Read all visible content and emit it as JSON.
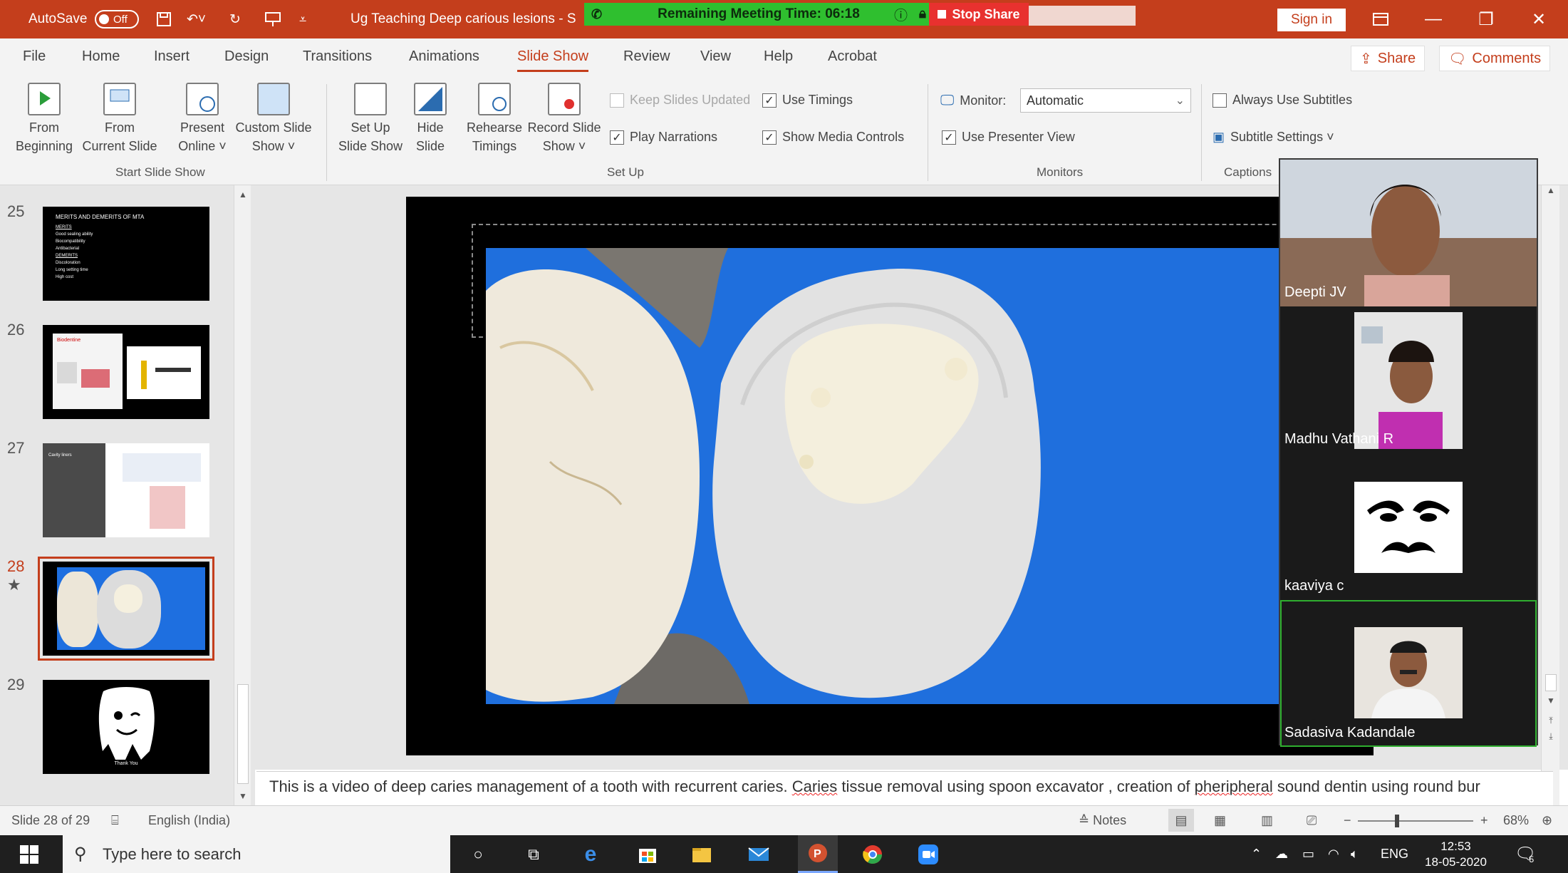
{
  "titlebar": {
    "autosave_label": "AutoSave",
    "autosave_state": "Off",
    "doc_title": "Ug Teaching Deep carious lesions  -  S",
    "meeting_timer": "Remaining Meeting Time: 06:18",
    "stop_share": "Stop Share",
    "sign_in": "Sign in",
    "accent_color": "#c43e1c"
  },
  "menu": {
    "tabs": [
      "File",
      "Home",
      "Insert",
      "Design",
      "Transitions",
      "Animations",
      "Slide Show",
      "Review",
      "View",
      "Help",
      "Acrobat"
    ],
    "active_tab": "Slide Show",
    "share": "Share",
    "comments": "Comments"
  },
  "ribbon": {
    "from_beginning": [
      "From",
      "Beginning"
    ],
    "from_current": [
      "From",
      "Current Slide"
    ],
    "present_online": [
      "Present",
      "Online ˅"
    ],
    "custom_slide_show": [
      "Custom Slide",
      "Show ˅"
    ],
    "setup_slide_show": [
      "Set Up",
      "Slide Show"
    ],
    "hide_slide": [
      "Hide",
      "Slide"
    ],
    "rehearse_timings": [
      "Rehearse",
      "Timings"
    ],
    "record_slide_show": [
      "Record Slide",
      "Show ˅"
    ],
    "keep_slides_updated": "Keep Slides Updated",
    "use_timings": "Use Timings",
    "play_narrations": "Play Narrations",
    "show_media_controls": "Show Media Controls",
    "monitor_label": "Monitor:",
    "monitor_value": "Automatic",
    "use_presenter_view": "Use Presenter View",
    "always_use_subtitles": "Always Use Subtitles",
    "subtitle_settings": "Subtitle Settings ˅",
    "groups": {
      "start": "Start Slide Show",
      "setup": "Set Up",
      "monitors": "Monitors",
      "captions": "Captions"
    }
  },
  "thumbnails": [
    {
      "num": "25",
      "title": "MERITS AND DEMERITS OF MTA",
      "lines": [
        "MERITS",
        "Good sealing ability",
        "Biocompatibility",
        "Antibacterial",
        "DEMERITS",
        "Discoloration",
        "Long setting time",
        "High cost"
      ]
    },
    {
      "num": "26",
      "title": "Biodentine"
    },
    {
      "num": "27",
      "title": "Cavity liners"
    },
    {
      "num": "28",
      "star": "★"
    },
    {
      "num": "29",
      "caption": "Thank You"
    }
  ],
  "participants": [
    {
      "name": "Deepti JV"
    },
    {
      "name": "Madhu Vathani R"
    },
    {
      "name": "kaaviya c"
    },
    {
      "name": "Sadasiva Kadandale"
    }
  ],
  "notes": {
    "part1": "This is a video of deep caries management of a tooth with recurrent caries. ",
    "squig1": "Caries",
    "part2": " tissue removal using spoon excavator , creation of ",
    "squig2": "pheripheral",
    "part3": " sound dentin using round bur"
  },
  "status": {
    "slide": "Slide 28 of 29",
    "language": "English (India)",
    "notes": "Notes",
    "zoom": "68%"
  },
  "taskbar": {
    "search_placeholder": "Type here to search",
    "lang": "ENG",
    "time": "12:53",
    "date": "18-05-2020",
    "notif_count": "5"
  }
}
